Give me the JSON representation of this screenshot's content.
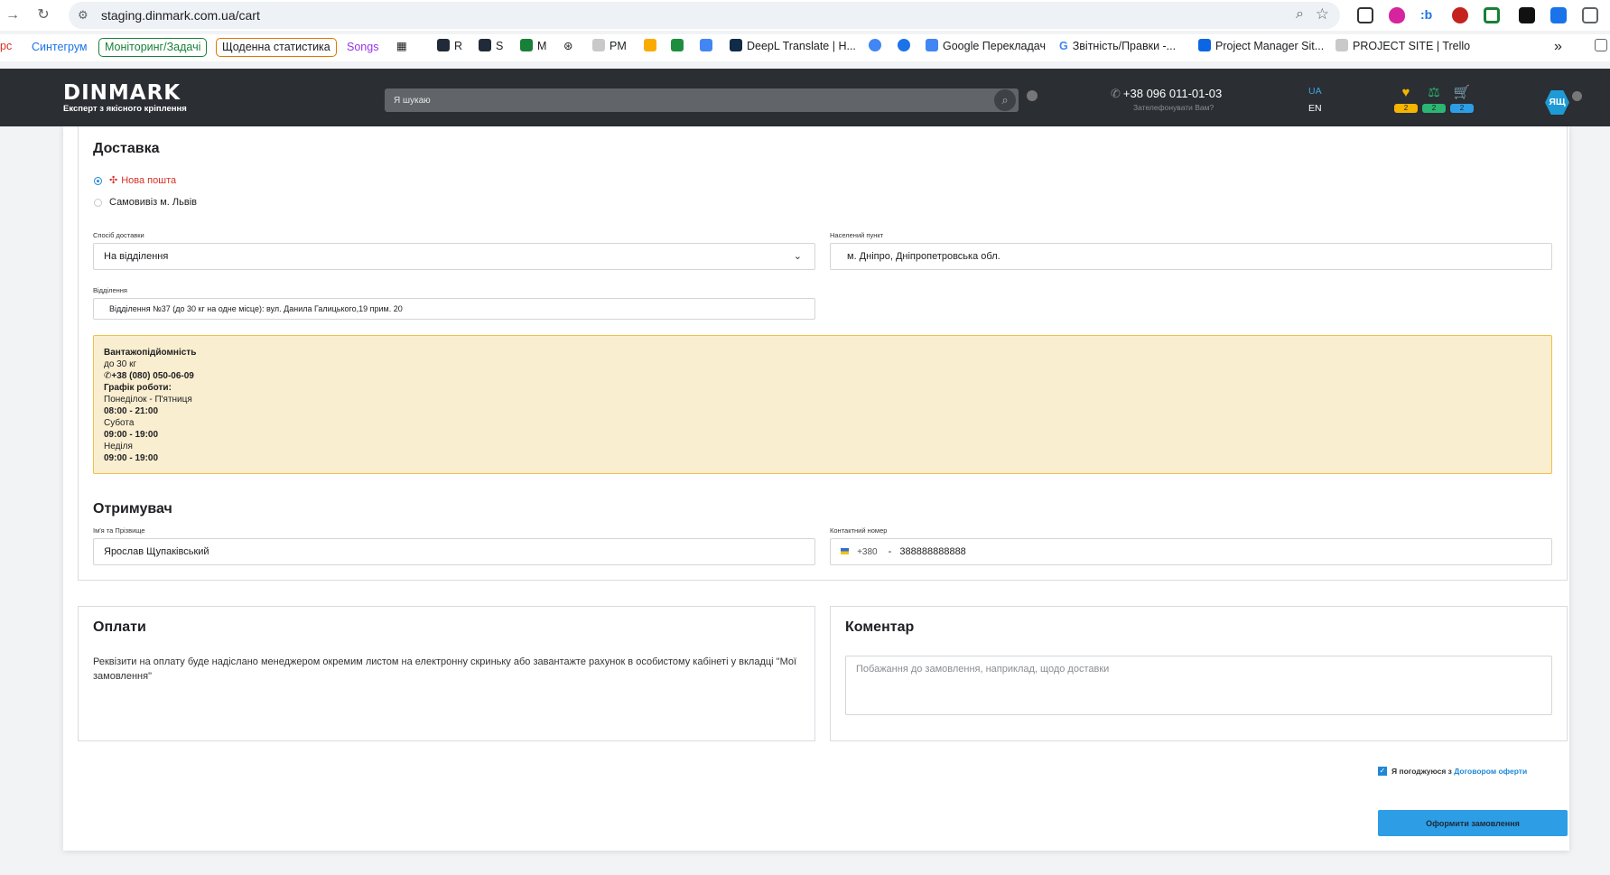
{
  "browser": {
    "url": "staging.dinmark.com.ua/cart",
    "bookmarks": [
      {
        "label": "рс",
        "color": "#d93025"
      },
      {
        "label": "Синтегрум",
        "color": "#1a73e8"
      },
      {
        "label": "Моніторинг/Задачі",
        "color": "#188038"
      },
      {
        "label": "Щоденна статистика",
        "color": "#e37400"
      },
      {
        "label": "Songs",
        "color": "#9334e6"
      },
      {
        "label": "R"
      },
      {
        "label": "S"
      },
      {
        "label": "M"
      },
      {
        "label": "PM"
      },
      {
        "label": "DeepL Translate | H..."
      },
      {
        "label": "Google Перекладач"
      },
      {
        "label": "Звітність/Правки -..."
      },
      {
        "label": "Project Manager Sit..."
      },
      {
        "label": "PROJECT SITE | Trello"
      }
    ],
    "more": "»"
  },
  "header": {
    "logo": "DINMARK",
    "tagline": "Експерт з якісного кріплення",
    "search_placeholder": "Я шукаю",
    "phone": "+38 096 011-01-03",
    "callback": "Зателефонувати Вам?",
    "lang_ua": "UA",
    "lang_en": "EN",
    "badges": {
      "favorites": "2",
      "compare": "2",
      "cart": "2"
    },
    "avatar": "ЯЩ"
  },
  "delivery": {
    "title": "Доставка",
    "options": [
      "Нова пошта",
      "Самовивіз м. Львів"
    ],
    "method_label": "Спосіб доставки",
    "method_value": "На відділення",
    "city_label": "Населений пункт",
    "city_value": "м. Дніпро, Дніпропетровська обл.",
    "branch_label": "Відділення",
    "branch_value": "Відділення №37 (до 30 кг на одне місце): вул. Данила Галицького,19 прим. 20",
    "info": {
      "capacity_title": "Вантажопідйомність",
      "capacity_value": "до 30 кг",
      "phone": "+38 (080) 050-06-09",
      "schedule_title": "Графік роботи:",
      "weekdays": "Понеділок - П'ятниця",
      "weekdays_hours": "08:00 - 21:00",
      "saturday": "Субота",
      "saturday_hours": "09:00 - 19:00",
      "sunday": "Неділя",
      "sunday_hours": "09:00 - 19:00"
    }
  },
  "recipient": {
    "title": "Отримувач",
    "name_label": "Ім'я та Прізвище",
    "name_value": "Ярослав Щупаківський",
    "phone_label": "Контактний номер",
    "phone_code": "+380",
    "phone_value": "388888888888"
  },
  "payment": {
    "title": "Оплати",
    "text": "Реквізити на оплату буде надіслано менеджером окремим листом на електронну скриньку або завантажте рахунок в особистому кабінеті у вкладці \"Мої замовлення\""
  },
  "comment": {
    "title": "Коментар",
    "placeholder": "Побажання до замовлення, наприклад, щодо доставки"
  },
  "agree": {
    "text": "Я погоджуюся з",
    "link": "Договором оферти"
  },
  "submit_label": "Оформити замовлення"
}
